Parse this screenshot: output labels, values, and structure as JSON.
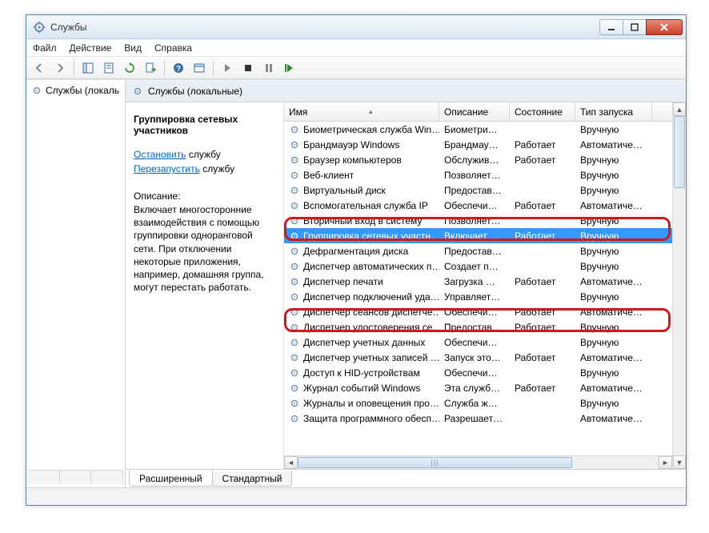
{
  "window": {
    "title": "Службы"
  },
  "menu": {
    "file": "Файл",
    "action": "Действие",
    "view": "Вид",
    "help": "Справка"
  },
  "tree": {
    "root": "Службы (локаль"
  },
  "pane": {
    "header": "Службы (локальные)"
  },
  "detail": {
    "title": "Группировка сетевых участников",
    "stop_link": "Остановить",
    "stop_suffix": " службу",
    "restart_link": "Перезапустить",
    "restart_suffix": " службу",
    "desc_label": "Описание:",
    "description": "Включает многосторонние взаимодействия с помощью группировки одноранговой сети. При отключении некоторые приложения, например, домашняя группа, могут перестать работать."
  },
  "columns": {
    "name": "Имя",
    "desc": "Описание",
    "state": "Состояние",
    "start": "Тип запуска"
  },
  "rows": [
    {
      "name": "Биометрическая служба Win…",
      "desc": "Биометри…",
      "state": "",
      "start": "Вручную",
      "sel": false,
      "hl": 0
    },
    {
      "name": "Брандмауэр Windows",
      "desc": "Брандмау…",
      "state": "Работает",
      "start": "Автоматиче…",
      "sel": false,
      "hl": 0
    },
    {
      "name": "Браузер компьютеров",
      "desc": "Обслужив…",
      "state": "Работает",
      "start": "Вручную",
      "sel": false,
      "hl": 0
    },
    {
      "name": "Веб-клиент",
      "desc": "Позволяет…",
      "state": "",
      "start": "Вручную",
      "sel": false,
      "hl": 0
    },
    {
      "name": "Виртуальный диск",
      "desc": "Предостав…",
      "state": "",
      "start": "Вручную",
      "sel": false,
      "hl": 0
    },
    {
      "name": "Вспомогательная служба IP",
      "desc": "Обеспечи…",
      "state": "Работает",
      "start": "Автоматиче…",
      "sel": false,
      "hl": 0
    },
    {
      "name": "Вторичный вход в систему",
      "desc": "Позволяет…",
      "state": "",
      "start": "Вручную",
      "sel": false,
      "hl": 0
    },
    {
      "name": "Группировка сетевых участн…",
      "desc": "Включает …",
      "state": "Работает",
      "start": "Вручную",
      "sel": true,
      "hl": 1
    },
    {
      "name": "Дефрагментация диска",
      "desc": "Предостав…",
      "state": "",
      "start": "Вручную",
      "sel": false,
      "hl": 0
    },
    {
      "name": "Диспетчер автоматических п…",
      "desc": "Создает п…",
      "state": "",
      "start": "Вручную",
      "sel": false,
      "hl": 0
    },
    {
      "name": "Диспетчер печати",
      "desc": "Загрузка …",
      "state": "Работает",
      "start": "Автоматиче…",
      "sel": false,
      "hl": 0
    },
    {
      "name": "Диспетчер подключений уда…",
      "desc": "Управляет…",
      "state": "",
      "start": "Вручную",
      "sel": false,
      "hl": 0
    },
    {
      "name": "Диспетчер сеансов диспетче…",
      "desc": "Обеспечи…",
      "state": "Работает",
      "start": "Автоматиче…",
      "sel": false,
      "hl": 0
    },
    {
      "name": "Диспетчер удостоверения се…",
      "desc": "Предостав…",
      "state": "Работает",
      "start": "Вручную",
      "sel": false,
      "hl": 2
    },
    {
      "name": "Диспетчер учетных данных",
      "desc": "Обеспечи…",
      "state": "",
      "start": "Вручную",
      "sel": false,
      "hl": 0
    },
    {
      "name": "Диспетчер учетных записей …",
      "desc": "Запуск это…",
      "state": "Работает",
      "start": "Автоматиче…",
      "sel": false,
      "hl": 0
    },
    {
      "name": "Доступ к HID-устройствам",
      "desc": "Обеспечи…",
      "state": "",
      "start": "Вручную",
      "sel": false,
      "hl": 0
    },
    {
      "name": "Журнал событий Windows",
      "desc": "Эта служб…",
      "state": "Работает",
      "start": "Автоматиче…",
      "sel": false,
      "hl": 0
    },
    {
      "name": "Журналы и оповещения про…",
      "desc": "Служба ж…",
      "state": "",
      "start": "Вручную",
      "sel": false,
      "hl": 0
    },
    {
      "name": "Защита программного обесп…",
      "desc": "Разрешает…",
      "state": "",
      "start": "Автоматиче…",
      "sel": false,
      "hl": 0
    }
  ],
  "tabs": {
    "extended": "Расширенный",
    "standard": "Стандартный"
  }
}
